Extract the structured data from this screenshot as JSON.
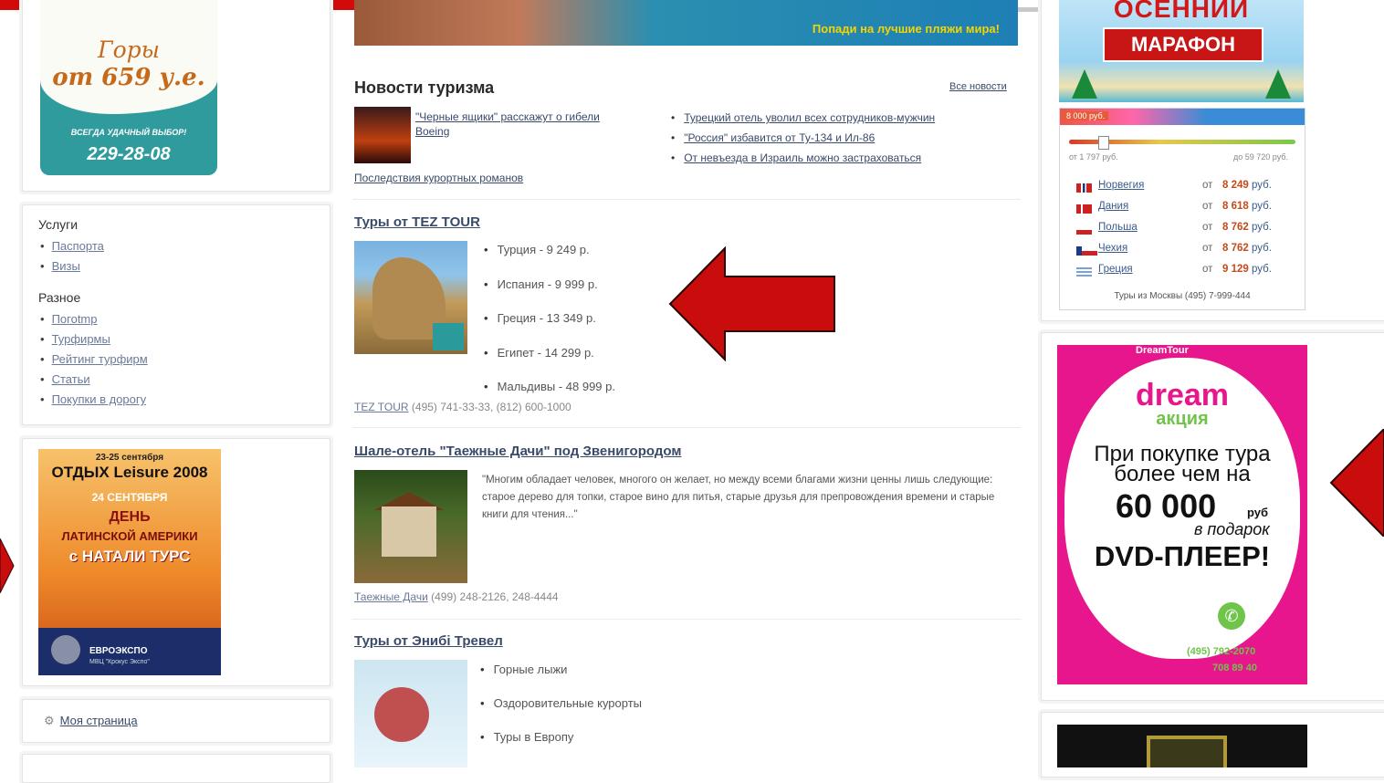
{
  "left": {
    "mountain_ad": {
      "line1": "Горы",
      "line2": "от 659 у.е.",
      "slogan": "ВСЕГДА УДАЧНЫЙ ВЫБОР!",
      "phone": "229-28-08"
    },
    "services_title": "Услуги",
    "services": [
      "Паспорта",
      "Визы"
    ],
    "misc_title": "Разное",
    "misc": [
      "Погоtmp",
      "Турфирмы",
      "Рейтинг турфирм",
      "Статьи",
      "Покупки в дорогу"
    ],
    "orange_ad": {
      "date": "23-25 сентября",
      "title": "ОТДЫХ Leisure 2008",
      "day": "24 СЕНТЯБРЯ",
      "den": "ДЕНЬ",
      "latin": "ЛАТИНСКОЙ АМЕРИКИ",
      "natali": "с НАТАЛИ ТУРС",
      "footer": "ЕВРОЭКСПО",
      "footer2": "МВЦ \"Крокус Экспо\""
    },
    "my_page": "Моя страница"
  },
  "center": {
    "top_ad_text": "Попади на лучшие пляжи мира!",
    "news": {
      "title": "Новости туризма",
      "all_link": "Все новости",
      "main_link": "\"Черные ящики\" расскажут о гибели Boeing",
      "second_link": "Последствия курортных романов",
      "items": [
        "Турецкий отель уволил всех сотрудников-мужчин",
        "\"Россия\" избавится от Ту-134 и Ил-86",
        "От невъезда в Израиль можно застраховаться"
      ]
    },
    "tez": {
      "title": "Туры от TEZ TOUR",
      "items": [
        "Турция - 9 249 р.",
        "Испания - 9 999 р.",
        "Греция - 13 349 р.",
        "Египет - 14 299 р.",
        "Мальдивы - 48 999 р."
      ],
      "contact_link": "TEZ TOUR",
      "contact_phones": "(495) 741-33-33, (812) 600-1000"
    },
    "shale": {
      "title": "Шале-отель \"Таежные Дачи\" под Звенигородом",
      "quote": "\"Многим обладает человек, многого он желает, но между всеми благами жизни ценны лишь следующие: старое дерево для топки, старое вино для питья, старые друзья для препровождения времени и старые книги для чтения...\"",
      "contact_link": "Таежные Дачи",
      "contact_phones": "(499) 248-2126, 248-4444"
    },
    "enibi": {
      "title": "Туры от Энибі Тревел",
      "items": [
        "Горные лыжи",
        "Оздоровительные курорты",
        "Туры в Европу"
      ]
    }
  },
  "right": {
    "marathon": {
      "line1": "ОСЕННИЙ",
      "line2": "МАРАФОН"
    },
    "price_widget": {
      "min_price": "8 000 руб.",
      "range_from": "от 1 797 руб.",
      "range_to": "до 59 720 руб.",
      "ot": "от",
      "rows": [
        {
          "country": "Норвегия",
          "price": "8 249",
          "currency": "руб."
        },
        {
          "country": "Дания",
          "price": "8 618",
          "currency": "руб."
        },
        {
          "country": "Польша",
          "price": "8 762",
          "currency": "руб."
        },
        {
          "country": "Чехия",
          "price": "8 762",
          "currency": "руб."
        },
        {
          "country": "Греция",
          "price": "9 129",
          "currency": "руб."
        }
      ],
      "footer": "Туры из Москвы (495) 7-999-444"
    },
    "dream_ad": {
      "brand_top": "DreamTour",
      "logo_small": "dream",
      "dream": "dream",
      "akciya": "акция",
      "line1": "При покупке тура",
      "line2": "более чем на",
      "amount": "60 000",
      "currency": "руб",
      "gift": "в подарок",
      "prize": "DVD-ПЛЕЕР!",
      "phone1": "(495) 792-2070",
      "phone2": "708 89 40"
    }
  },
  "colors": {
    "accent_red": "#d20a0a",
    "link": "#3a4a6a",
    "dream_pink": "#e8168c",
    "teal": "#2f9b9c"
  }
}
